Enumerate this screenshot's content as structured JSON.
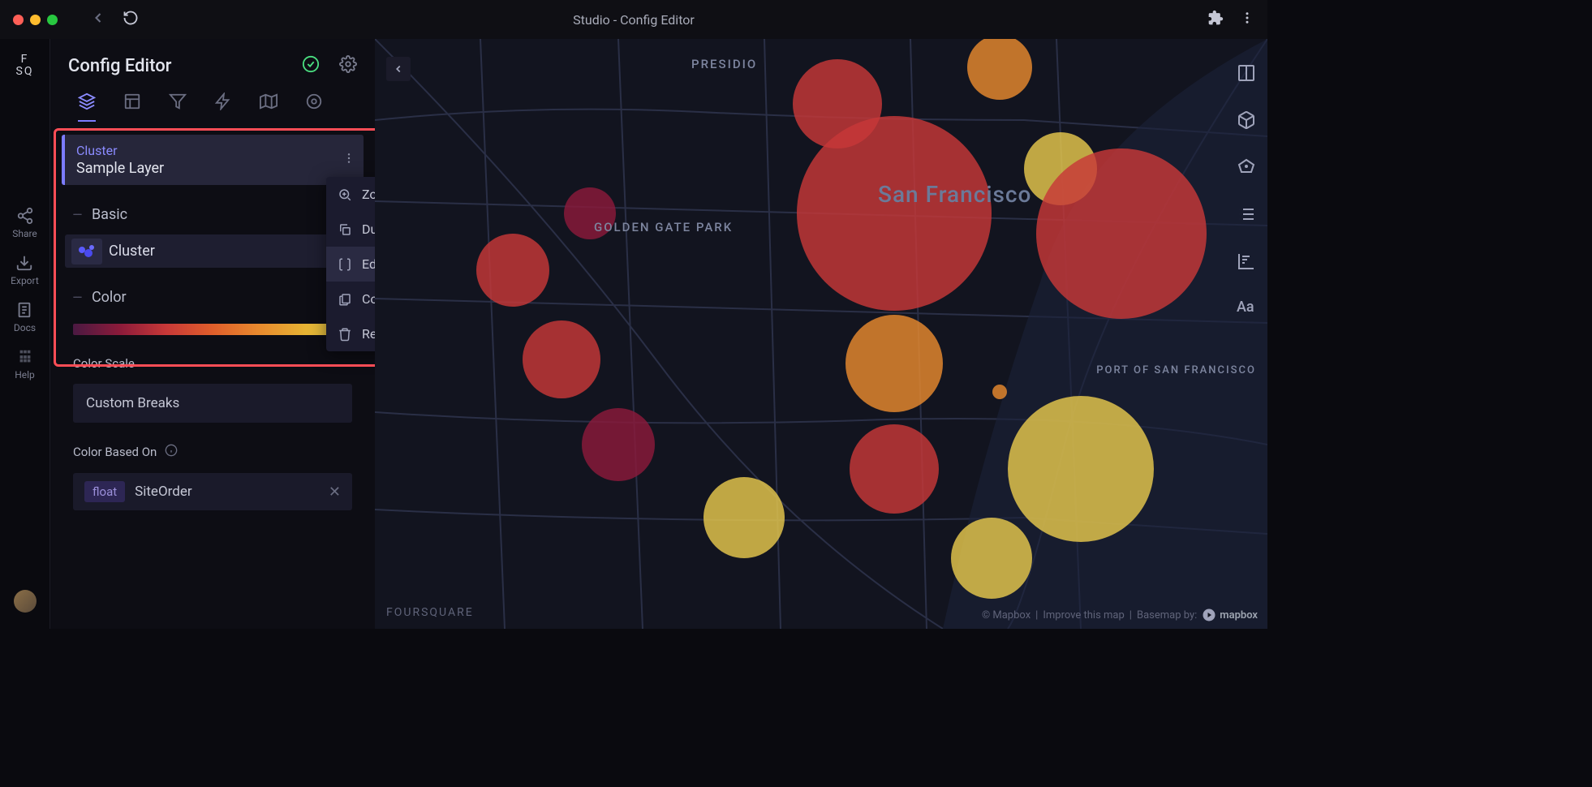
{
  "window": {
    "title": "Studio - Config Editor"
  },
  "rail": {
    "logo_line1": "F",
    "logo_line2": "SQ",
    "items": [
      {
        "label": "Share"
      },
      {
        "label": "Export"
      },
      {
        "label": "Docs"
      },
      {
        "label": "Help"
      }
    ]
  },
  "panel": {
    "title": "Config Editor",
    "layers": [
      {
        "type": "Cluster",
        "name": "Sample Layer"
      }
    ],
    "sections": {
      "basic": {
        "heading": "Basic",
        "sub_label": "Cluster"
      },
      "color": {
        "heading": "Color"
      },
      "scale": {
        "heading": "Color Scale",
        "value": "Custom Breaks"
      },
      "based": {
        "heading": "Color Based On",
        "pill": "float",
        "value": "SiteOrder"
      }
    }
  },
  "context_menu": {
    "items": [
      {
        "label": "Zoom to"
      },
      {
        "label": "Duplicate"
      },
      {
        "label": "Edit config"
      },
      {
        "label": "Copy config"
      },
      {
        "label": "Remove"
      }
    ]
  },
  "map": {
    "labels": {
      "presidio": "PRESIDIO",
      "ggp": "GOLDEN GATE PARK",
      "sf": "San Francisco",
      "port": "PORT OF SAN FRANCISCO"
    },
    "watermark": "FOURSQUARE",
    "attribution": {
      "mapbox": "© Mapbox",
      "improve": "Improve this map",
      "basemap": "Basemap by:",
      "brand": "mapbox"
    }
  }
}
